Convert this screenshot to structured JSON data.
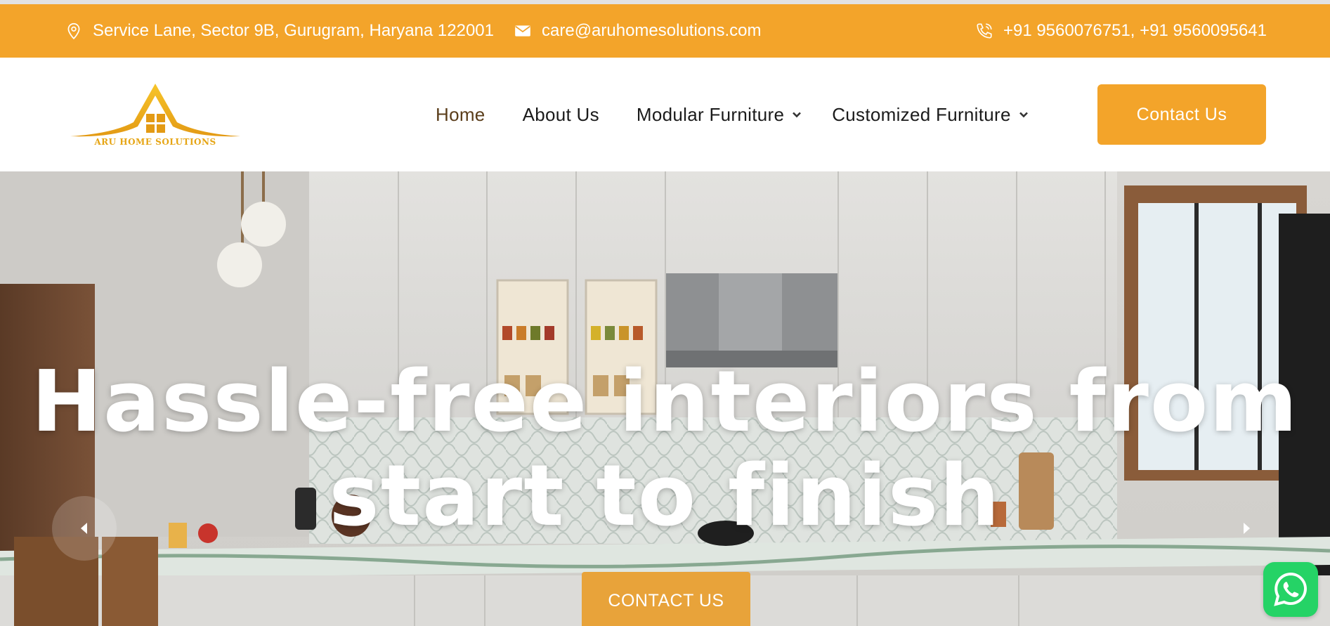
{
  "topbar": {
    "address": "Service Lane, Sector 9B, Gurugram, Haryana 122001",
    "email": "care@aruhomesolutions.com",
    "phones": "+91 9560076751,  +91 9560095641",
    "background": "#f3a42a"
  },
  "header": {
    "logo_text": "ARU HOME SOLUTIONS",
    "nav": {
      "home": "Home",
      "about": "About Us",
      "modular": "Modular Furniture",
      "customized": "Customized Furniture"
    },
    "contact_button": "Contact Us"
  },
  "hero": {
    "title_line1": "Hassle-free interiors from",
    "title_line2": "start to finish",
    "cta": "CONTACT US"
  },
  "icons": {
    "address": "map-pin-icon",
    "email": "envelope-icon",
    "phone": "phone-icon",
    "dropdown": "chevron-down-icon",
    "prev": "chevron-left-icon",
    "next": "chevron-right-icon",
    "whatsapp": "whatsapp-icon"
  },
  "colors": {
    "accent": "#f3a42a",
    "hero_cta": "#e8a33a",
    "whatsapp": "#25d366"
  }
}
